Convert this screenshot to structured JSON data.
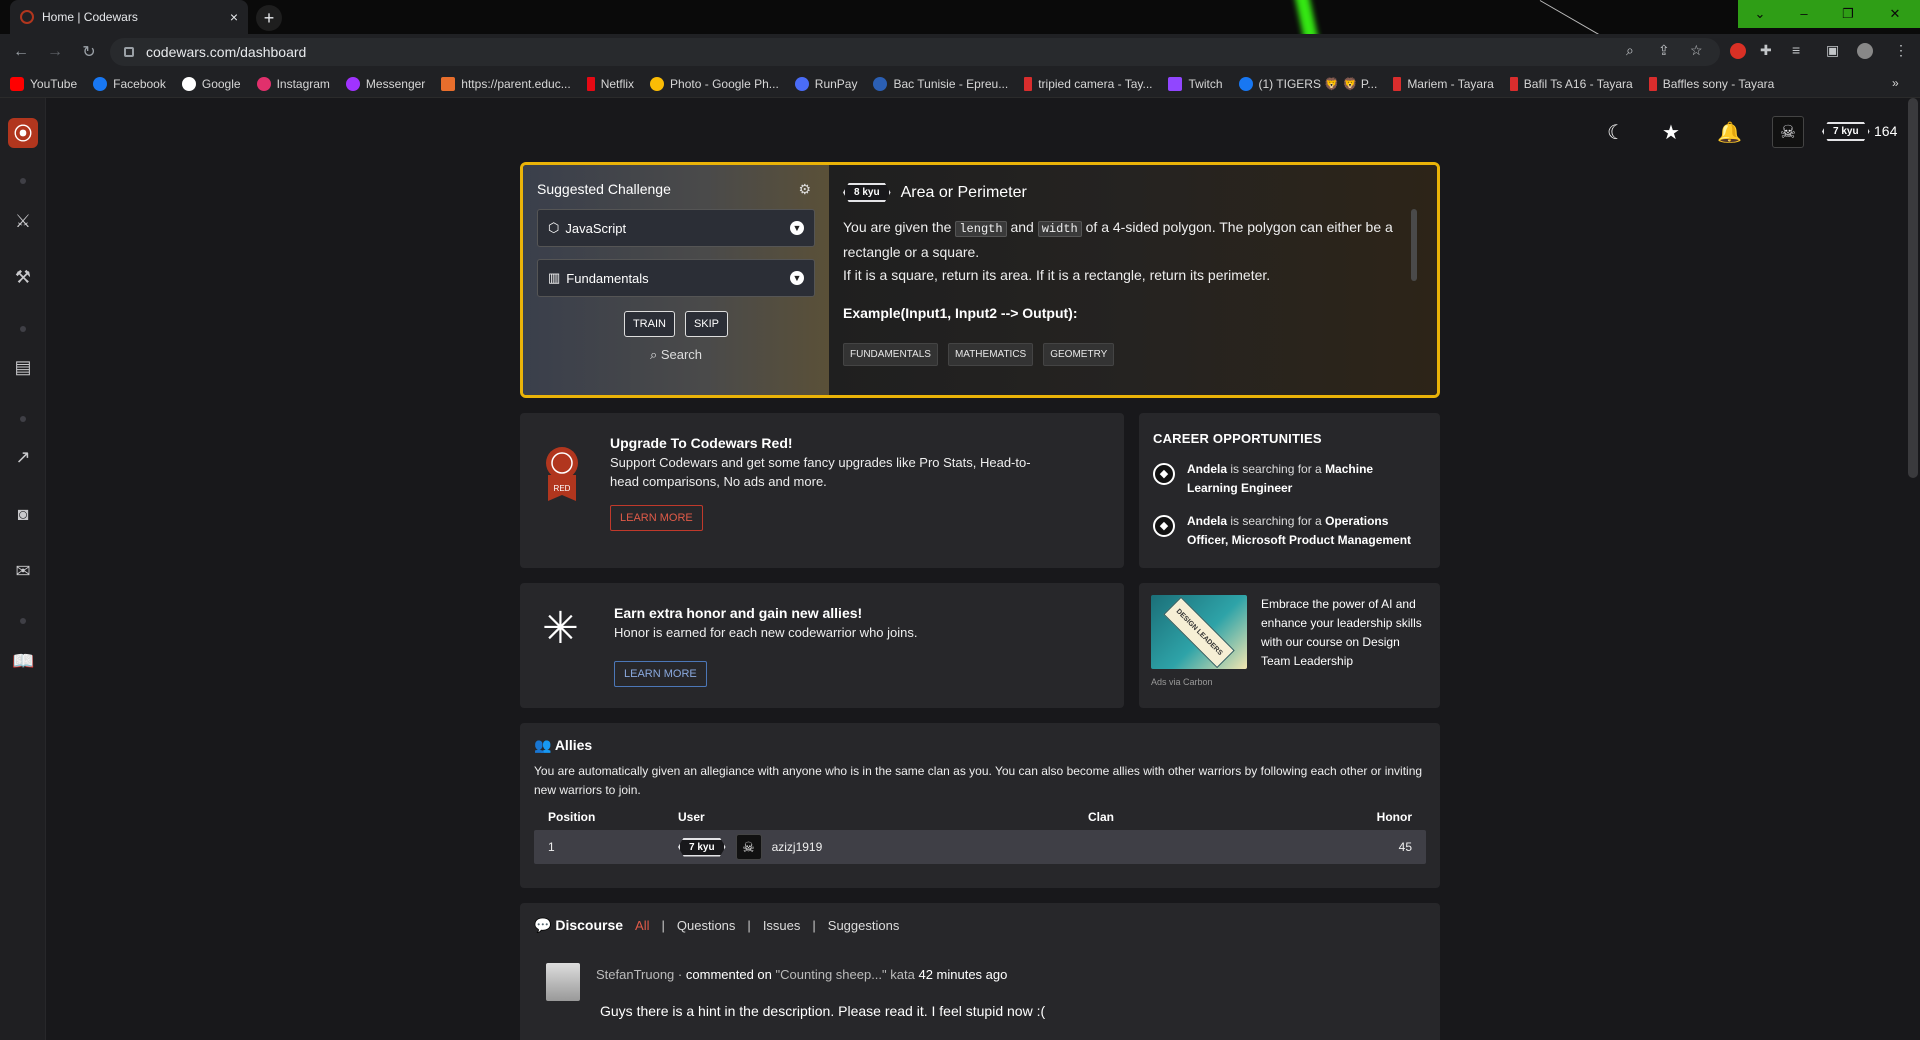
{
  "browser": {
    "tab_title": "Home | Codewars",
    "tab_close": "×",
    "new_tab": "+",
    "url": "codewars.com/dashboard",
    "window_controls": [
      "⌄",
      "–",
      "❐",
      "✕"
    ],
    "bookmarks": [
      {
        "label": "YouTube",
        "color": "#ff0000"
      },
      {
        "label": "Facebook",
        "color": "#1877f2"
      },
      {
        "label": "Google",
        "color": "#ffffff"
      },
      {
        "label": "Instagram",
        "color": "#e1306c"
      },
      {
        "label": "Messenger",
        "color": "#a033ff"
      },
      {
        "label": "https://parent.educ...",
        "color": "#e86e2c"
      },
      {
        "label": "Netflix",
        "color": "#e50914"
      },
      {
        "label": "Photo - Google Ph...",
        "color": "#fbbc05"
      },
      {
        "label": "RunPay",
        "color": "#4a6cf7"
      },
      {
        "label": "Bac Tunisie - Epreu...",
        "color": "#2b5fb4"
      },
      {
        "label": "tripied camera - Tay...",
        "color": "#d92d2d"
      },
      {
        "label": "Twitch",
        "color": "#9146ff"
      },
      {
        "label": "(1) TIGERS 🦁 🦁 P...",
        "color": "#1877f2"
      },
      {
        "label": "Mariem - Tayara",
        "color": "#d92d2d"
      },
      {
        "label": "Bafil Ts A16 - Tayara",
        "color": "#d92d2d"
      },
      {
        "label": "Baffles sony - Tayara",
        "color": "#d92d2d"
      }
    ],
    "bookmarks_more": "»"
  },
  "header": {
    "rank": "7 kyu",
    "honor": "164"
  },
  "suggested": {
    "heading": "Suggested Challenge",
    "language": "JavaScript",
    "category": "Fundamentals",
    "train_label": "TRAIN",
    "skip_label": "SKIP",
    "search_label": "Search",
    "kata_rank": "8 kyu",
    "kata_name": "Area or Perimeter",
    "desc_1a": "You are given the ",
    "desc_code1": "length",
    "desc_1b": " and ",
    "desc_code2": "width",
    "desc_1c": " of a 4-sided polygon. The polygon can either be a rectangle or a square.",
    "desc_2": "If it is a square, return its area. If it is a rectangle, return its perimeter.",
    "example": "Example(Input1, Input2 --> Output):",
    "tags": [
      "FUNDAMENTALS",
      "MATHEMATICS",
      "GEOMETRY"
    ],
    "accent": "#eab308"
  },
  "upgrade": {
    "title": "Upgrade To Codewars Red!",
    "text": "Support Codewars and get some fancy upgrades like Pro Stats, Head-to-head comparisons, No ads and more.",
    "badge_label": "RED",
    "button": "LEARN MORE"
  },
  "career": {
    "title": "CAREER OPPORTUNITIES",
    "jobs": [
      {
        "company": "Andela",
        "mid": " is searching for a ",
        "role": "Machine Learning Engineer"
      },
      {
        "company": "Andela",
        "mid": " is searching for a ",
        "role": "Operations Officer, Microsoft Product Management"
      }
    ]
  },
  "honor_promo": {
    "title": "Earn extra honor and gain new allies!",
    "text": "Honor is earned for each new codewarrior who joins.",
    "button": "LEARN MORE"
  },
  "ad": {
    "image_label": "DESIGN LEADERS",
    "text": "Embrace the power of AI and enhance your leadership skills with our course on Design Team Leadership",
    "via": "Ads via Carbon"
  },
  "allies": {
    "title": "Allies",
    "text": "You are automatically given an allegiance with anyone who is in the same clan as you. You can also become allies with other warriors by following each other or inviting new warriors to join.",
    "columns": [
      "Position",
      "User",
      "Clan",
      "Honor"
    ],
    "rows": [
      {
        "position": "1",
        "rank": "7 kyu",
        "user": "azizj1919",
        "clan": "",
        "honor": "45"
      }
    ]
  },
  "discourse": {
    "title": "Discourse",
    "tabs": [
      "All",
      "Questions",
      "Issues",
      "Suggestions"
    ],
    "post": {
      "user": "StefanTruong",
      "dot": "·",
      "action": "commented on",
      "target": "\"Counting sheep...\" kata",
      "time": "42 minutes ago",
      "body": "Guys there is a hint in the description. Please read it. I feel stupid now :("
    }
  }
}
